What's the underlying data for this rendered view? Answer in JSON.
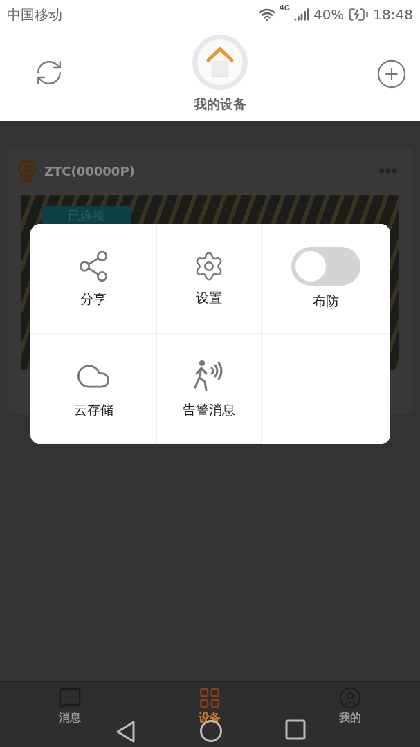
{
  "status_bar": {
    "carrier": "中国移动",
    "network": "4G",
    "battery": "40%",
    "time": "18:48"
  },
  "header": {
    "title": "我的设备"
  },
  "device": {
    "name": "ZTC(00000P)",
    "status": "已连接"
  },
  "menu": [
    {
      "kind": "share",
      "label": "分享"
    },
    {
      "kind": "settings",
      "label": "设置"
    },
    {
      "kind": "toggle",
      "label": "布防",
      "on": false
    },
    {
      "kind": "cloud",
      "label": "云存储"
    },
    {
      "kind": "alarm",
      "label": "告警消息"
    }
  ],
  "tabs": [
    {
      "kind": "messages",
      "label": "消息",
      "selected": false
    },
    {
      "kind": "devices",
      "label": "设备",
      "selected": true
    },
    {
      "kind": "profile",
      "label": "我的",
      "selected": false
    }
  ]
}
